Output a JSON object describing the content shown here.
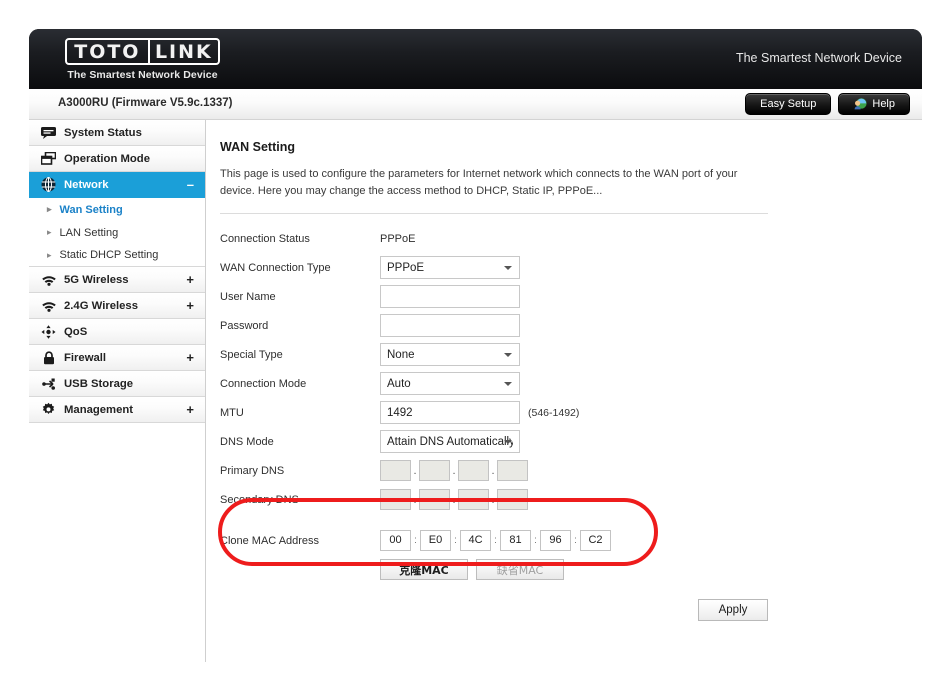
{
  "header": {
    "logo_left": "TOTO",
    "logo_right": "LINK",
    "logo_tagline": "The Smartest Network Device",
    "right_tagline": "The Smartest Network Device",
    "model": "A3000RU (Firmware V5.9c.1337)",
    "easy_setup_label": "Easy Setup",
    "help_label": "Help"
  },
  "sidebar": {
    "items": [
      {
        "label": "System Status",
        "icon": "monitor-icon",
        "expander": ""
      },
      {
        "label": "Operation Mode",
        "icon": "windows-icon",
        "expander": ""
      },
      {
        "label": "Network",
        "icon": "globe-icon",
        "expander": "–",
        "active": true
      },
      {
        "label": "5G Wireless",
        "icon": "wifi-icon",
        "expander": "+"
      },
      {
        "label": "2.4G Wireless",
        "icon": "wifi-icon",
        "expander": "+"
      },
      {
        "label": "QoS",
        "icon": "qos-icon",
        "expander": ""
      },
      {
        "label": "Firewall",
        "icon": "lock-icon",
        "expander": "+"
      },
      {
        "label": "USB Storage",
        "icon": "usb-icon",
        "expander": ""
      },
      {
        "label": "Management",
        "icon": "gear-icon",
        "expander": "+"
      }
    ],
    "sub_items": [
      {
        "label": "Wan Setting",
        "current": true
      },
      {
        "label": "LAN Setting",
        "current": false
      },
      {
        "label": "Static DHCP Setting",
        "current": false
      }
    ]
  },
  "main": {
    "title": "WAN Setting",
    "description": "This page is used to configure the parameters for Internet network which connects to the WAN port of your device. Here you may change the access method to DHCP, Static IP, PPPoE...",
    "connection_status_label": "Connection Status",
    "connection_status_value": "PPPoE",
    "wan_type_label": "WAN Connection Type",
    "wan_type_value": "PPPoE",
    "username_label": "User Name",
    "username_value": "",
    "password_label": "Password",
    "password_value": "",
    "special_type_label": "Special Type",
    "special_type_value": "None",
    "connection_mode_label": "Connection Mode",
    "connection_mode_value": "Auto",
    "mtu_label": "MTU",
    "mtu_value": "1492",
    "mtu_hint": "(546-1492)",
    "dns_mode_label": "DNS Mode",
    "dns_mode_value": "Attain DNS Automatically",
    "primary_dns_label": "Primary DNS",
    "primary_dns": [
      "",
      "",
      "",
      ""
    ],
    "secondary_dns_label": "Secondary DNS",
    "secondary_dns": [
      "",
      "",
      "",
      ""
    ],
    "clone_mac_label": "Clone MAC Address",
    "clone_mac_octets": [
      "00",
      "E0",
      "4C",
      "81",
      "96",
      "C2"
    ],
    "clone_mac_button": "克隆MAC",
    "default_mac_button": "缺省MAC",
    "apply_label": "Apply",
    "dns_separator": ".",
    "mac_separator": ":"
  },
  "annotation": {
    "highlight_color": "#ee1c1c"
  }
}
